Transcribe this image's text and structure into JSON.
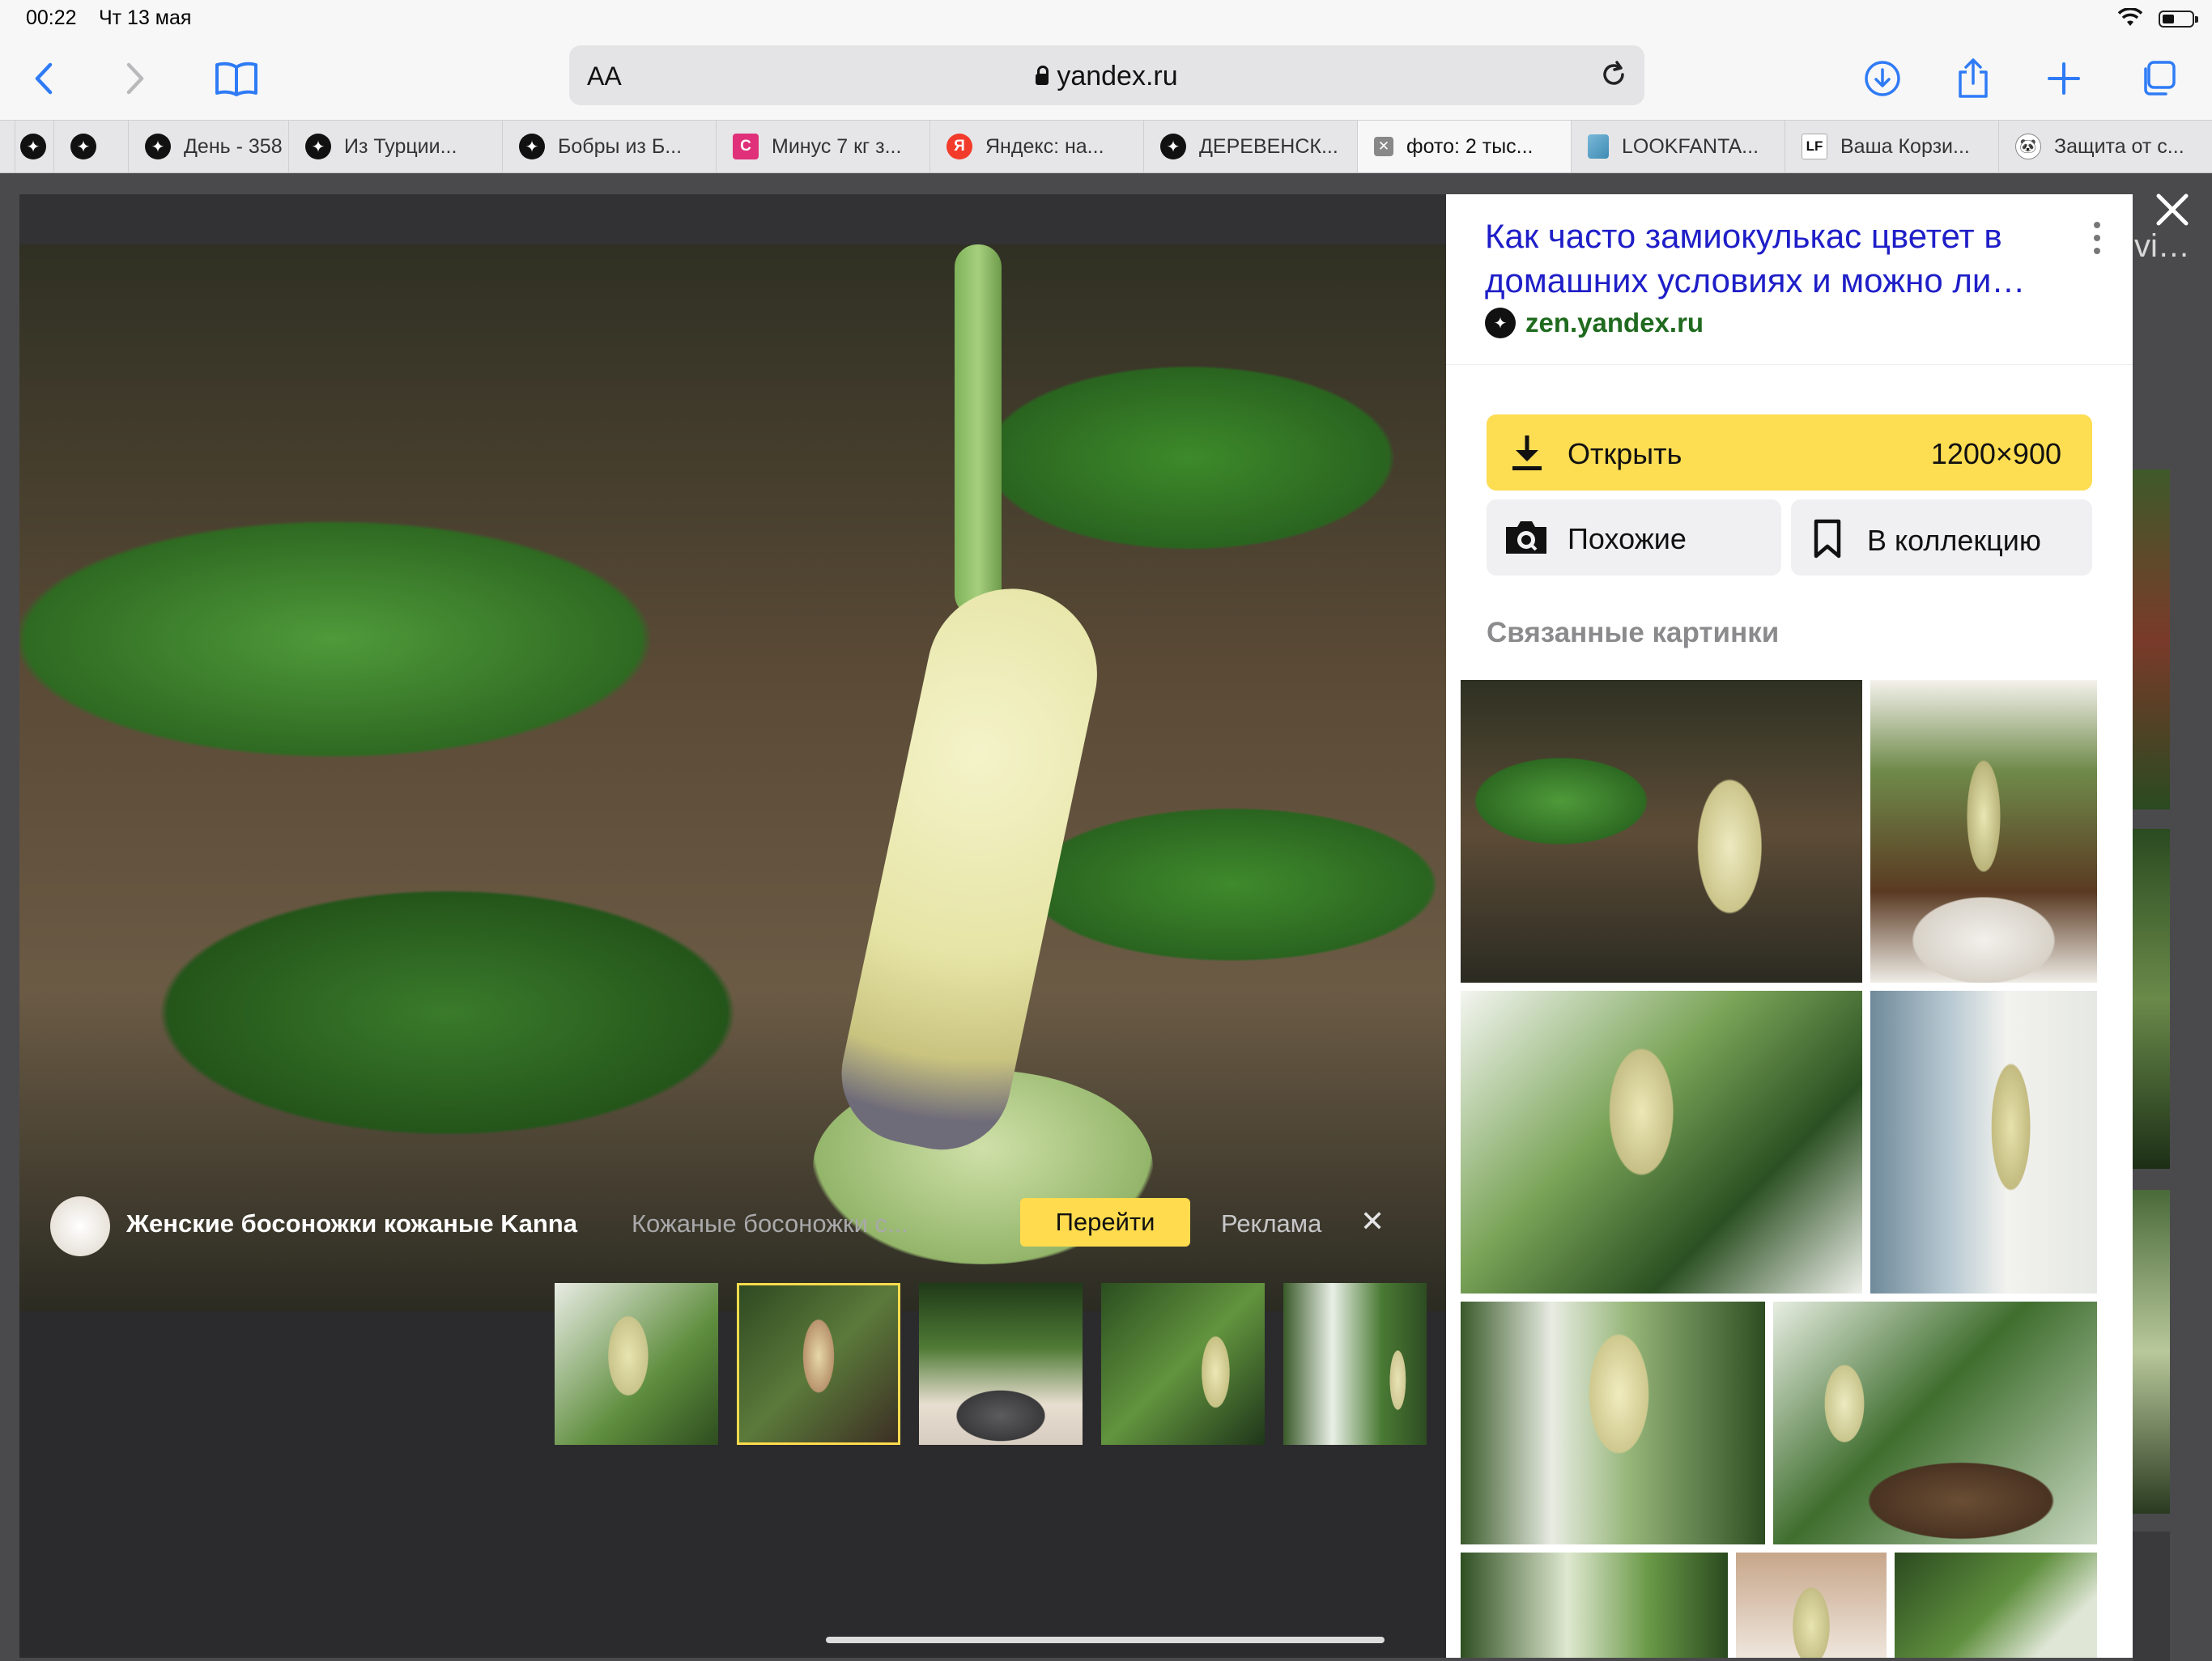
{
  "status": {
    "time": "00:22",
    "date": "Чт 13 мая"
  },
  "browser": {
    "url_host": "yandex.ru",
    "reader_label": "AA"
  },
  "tabs": [
    {
      "label": ""
    },
    {
      "label": ""
    },
    {
      "label": "День - 358"
    },
    {
      "label": "Из Турции..."
    },
    {
      "label": "Бобры из Б..."
    },
    {
      "label": "Минус 7 кг з..."
    },
    {
      "label": "Яндекс: на..."
    },
    {
      "label": "ДЕРЕВЕНСК..."
    },
    {
      "label": "фото: 2 тыс..."
    },
    {
      "label": "LOOKFANTA..."
    },
    {
      "label": "Ваша Корзи..."
    },
    {
      "label": "Защита от с..."
    }
  ],
  "favicon_text": {
    "c": "C",
    "ya": "Я",
    "x": "✕",
    "lf": "LF",
    "panda": "🐼"
  },
  "ad": {
    "title": "Женские босоножки кожаные Kanna",
    "description": "Кожаные босоножки с...",
    "go_label": "Перейти",
    "ad_label": "Реклама",
    "close": "✕"
  },
  "panel": {
    "title": "Как часто замиокулькас цветет в домашних условиях и можно ли…",
    "source": "zen.yandex.ru",
    "open_label": "Открыть",
    "image_size": "1200×900",
    "similar_label": "Похожие",
    "collection_label": "В коллекцию",
    "related_heading": "Связанные картинки"
  },
  "behind": {
    "title_fragment": "vi…"
  },
  "colors": {
    "accent_yellow": "#fddd52",
    "link_blue": "#1e1ec8",
    "source_green": "#1f6a1f",
    "ios_blue": "#2f7bf6"
  }
}
